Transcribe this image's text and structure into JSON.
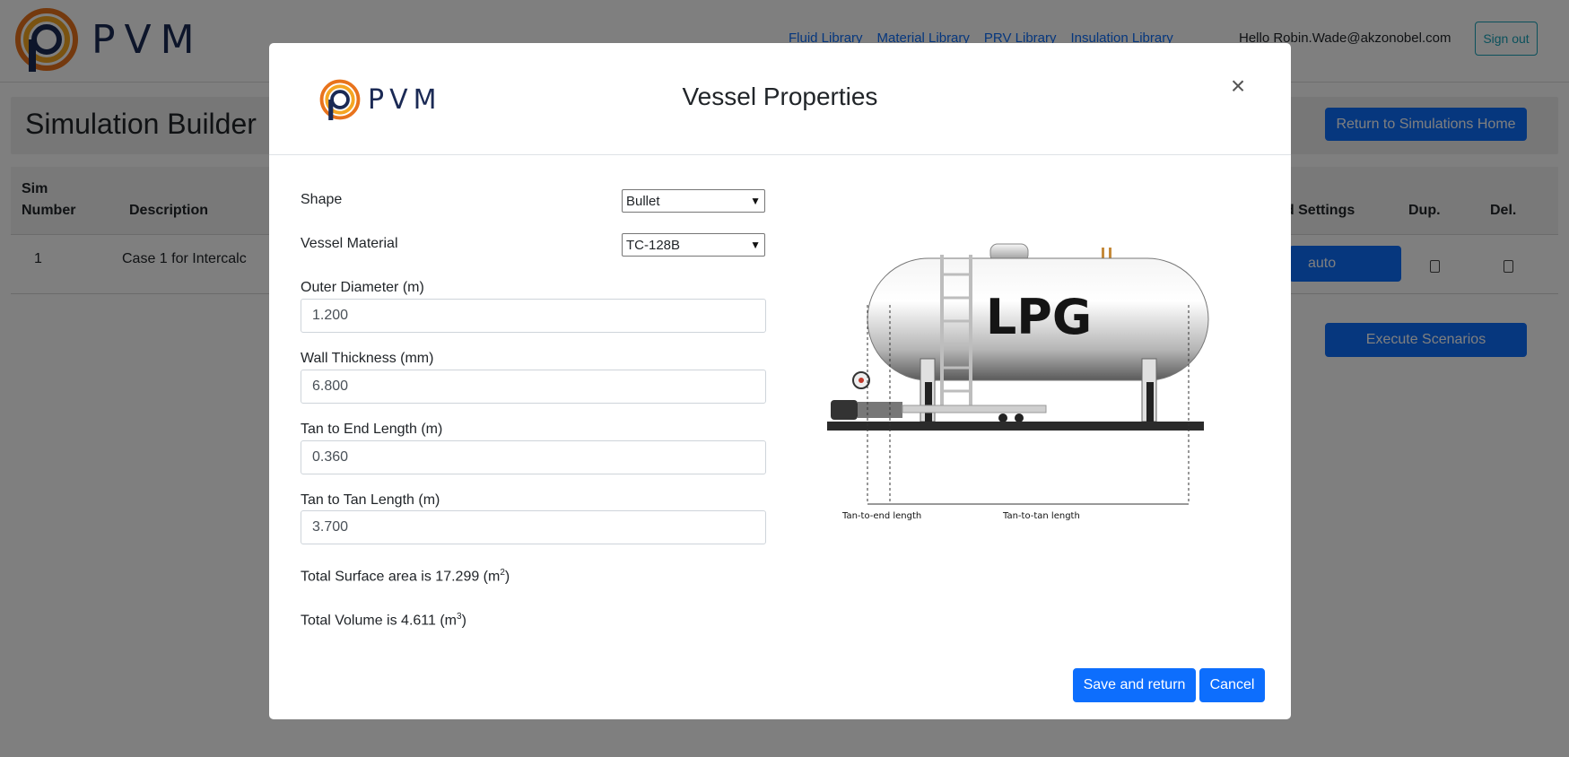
{
  "nav": {
    "brand": "PVM",
    "links": [
      "Fluid Library",
      "Material Library",
      "PRV Library",
      "Insulation Library"
    ],
    "hello": "Hello Robin.Wade@akzonobel.com",
    "signout": "Sign out"
  },
  "page": {
    "title": "Simulation Builder",
    "return_btn": "Return to Simulations Home",
    "execute_btn": "Execute Scenarios"
  },
  "table": {
    "headers": {
      "sim_number_line1": "Sim",
      "sim_number_line2": "Number",
      "description": "Description",
      "settings": "ed Settings",
      "dup": "Dup.",
      "del": "Del."
    },
    "row": {
      "number": "1",
      "description": "Case 1 for Intercalc",
      "auto_btn": "auto"
    }
  },
  "modal": {
    "brand": "PVM",
    "title": "Vessel Properties",
    "close": "×",
    "shape_label": "Shape",
    "shape_value": "Bullet",
    "material_label": "Vessel Material",
    "material_value": "TC-128B",
    "outer_diameter_label": "Outer Diameter (m)",
    "outer_diameter_value": "1.200",
    "wall_thickness_label": "Wall Thickness (mm)",
    "wall_thickness_value": "6.800",
    "tan_end_label": "Tan to End Length (m)",
    "tan_end_value": "0.360",
    "tan_tan_label": "Tan to Tan Length (m)",
    "tan_tan_value": "3.700",
    "surface_text": "Total Surface area is 17.299 (m",
    "surface_sup": "2",
    "volume_text": "Total Volume is 4.611 (m",
    "volume_sup": "3",
    "close_paren": ")",
    "diagram": {
      "tank_label": "LPG",
      "tan_end_caption": "Tan-to-end length",
      "tan_tan_caption": "Tan-to-tan length"
    },
    "save_btn": "Save and return",
    "cancel_btn": "Cancel"
  }
}
